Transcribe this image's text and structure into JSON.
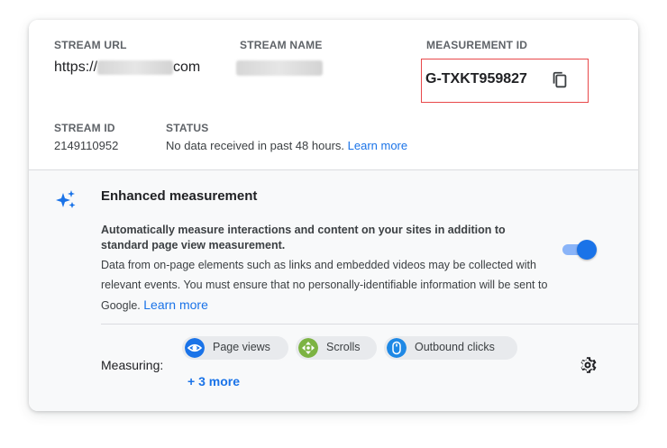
{
  "stream": {
    "url_label": "STREAM URL",
    "url_prefix": "https://",
    "url_suffix": "com",
    "name_label": "STREAM NAME",
    "measurement_label": "MEASUREMENT ID",
    "measurement_id": "G-TXKT959827",
    "id_label": "STREAM ID",
    "id_value": "2149110952",
    "status_label": "STATUS",
    "status_text": "No data received in past 48 hours.",
    "status_link": "Learn more"
  },
  "enhanced": {
    "title": "Enhanced measurement",
    "desc_bold": "Automatically measure interactions and content on your sites in addition to standard page view measurement.",
    "desc": "Data from on-page elements such as links and embedded videos may be collected with relevant events. You must ensure that no personally-identifiable information will be sent to Google.",
    "learn_more": "Learn more",
    "toggle_on": true,
    "measuring_label": "Measuring:",
    "chips": [
      {
        "label": "Page views",
        "icon": "eye-icon",
        "color": "#1a73e8"
      },
      {
        "label": "Scrolls",
        "icon": "scroll-icon",
        "color": "#7cb342"
      },
      {
        "label": "Outbound clicks",
        "icon": "mouse-icon",
        "color": "#1e88e5"
      }
    ],
    "more_link": "+ 3 more"
  },
  "colors": {
    "accent": "#1a73e8",
    "highlight_box": "#e8484a",
    "panel_bg": "#f8f9fa"
  }
}
